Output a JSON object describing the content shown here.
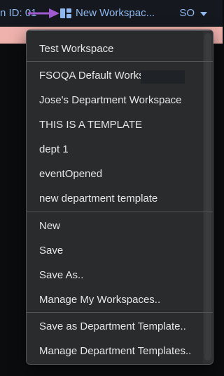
{
  "topbar": {
    "session_text": "n ID: 01",
    "workspace_button_label": "New Workspac...",
    "user_label": "SO"
  },
  "menu": {
    "sections": [
      {
        "items": [
          "Test Workspace"
        ]
      },
      {
        "items": [
          "FSOQA Default Works",
          "Jose's Department Workspace",
          "THIS IS A TEMPLATE",
          "dept 1",
          "eventOpened",
          "new department template"
        ]
      },
      {
        "items": [
          "New",
          "Save",
          "Save As..",
          "Manage My Workspaces.."
        ]
      },
      {
        "items": [
          "Save as Department Template..",
          "Manage Department Templates.."
        ]
      }
    ]
  },
  "colors": {
    "topbar_bg": "#15191f",
    "link_blue": "#8fb8ee",
    "menu_bg": "#2a2b2d",
    "menu_border": "#4f5154",
    "banner_pink": "#f0b2ad",
    "arrow_purple": "#a05ad0"
  },
  "icons": {
    "workspace": "workspace-layout-icon",
    "user_dropdown": "chevron-down-icon",
    "annotation": "pointer-arrow-icon"
  }
}
